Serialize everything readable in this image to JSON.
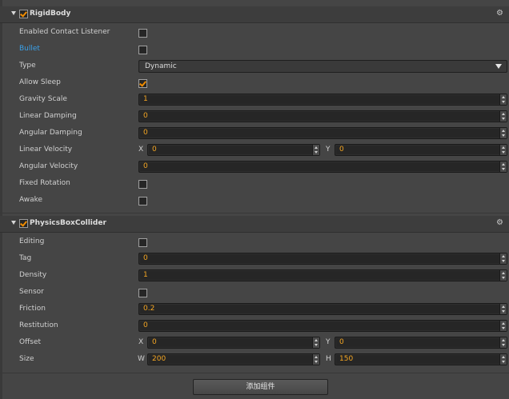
{
  "rigidbody": {
    "title": "RigidBody",
    "gear_icon": "gear-icon",
    "enabled": true,
    "enabled_contact_listener": {
      "label": "Enabled Contact Listener",
      "checked": false
    },
    "bullet": {
      "label": "Bullet",
      "checked": false
    },
    "type": {
      "label": "Type",
      "value": "Dynamic"
    },
    "allow_sleep": {
      "label": "Allow Sleep",
      "checked": true
    },
    "gravity_scale": {
      "label": "Gravity Scale",
      "value": "1"
    },
    "linear_damping": {
      "label": "Linear Damping",
      "value": "0"
    },
    "angular_damping": {
      "label": "Angular Damping",
      "value": "0"
    },
    "linear_velocity": {
      "label": "Linear Velocity",
      "x_label": "X",
      "x": "0",
      "y_label": "Y",
      "y": "0"
    },
    "angular_velocity": {
      "label": "Angular Velocity",
      "value": "0"
    },
    "fixed_rotation": {
      "label": "Fixed Rotation",
      "checked": false
    },
    "awake": {
      "label": "Awake",
      "checked": false
    }
  },
  "collider": {
    "title": "PhysicsBoxCollider",
    "gear_icon": "gear-icon",
    "enabled": true,
    "editing": {
      "label": "Editing",
      "checked": false
    },
    "tag": {
      "label": "Tag",
      "value": "0"
    },
    "density": {
      "label": "Density",
      "value": "1"
    },
    "sensor": {
      "label": "Sensor",
      "checked": false
    },
    "friction": {
      "label": "Friction",
      "value": "0.2"
    },
    "restitution": {
      "label": "Restitution",
      "value": "0"
    },
    "offset": {
      "label": "Offset",
      "x_label": "X",
      "x": "0",
      "y_label": "Y",
      "y": "0"
    },
    "size": {
      "label": "Size",
      "w_label": "W",
      "w": "200",
      "h_label": "H",
      "h": "150"
    }
  },
  "add_component_label": "添加组件",
  "colors": {
    "accent": "#f5a623",
    "link": "#3aa0e8",
    "background": "#454545"
  }
}
